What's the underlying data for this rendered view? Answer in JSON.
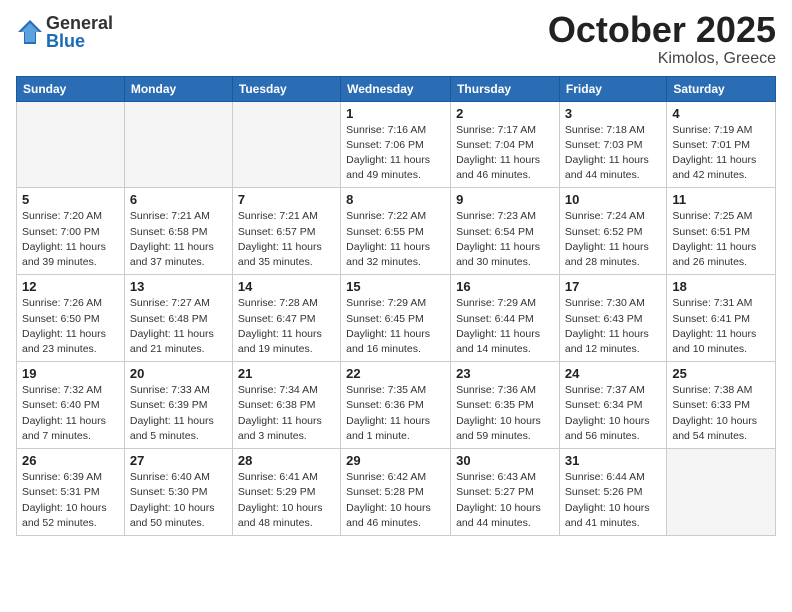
{
  "logo": {
    "general": "General",
    "blue": "Blue"
  },
  "title": "October 2025",
  "subtitle": "Kimolos, Greece",
  "days_of_week": [
    "Sunday",
    "Monday",
    "Tuesday",
    "Wednesday",
    "Thursday",
    "Friday",
    "Saturday"
  ],
  "weeks": [
    [
      {
        "day": "",
        "info": ""
      },
      {
        "day": "",
        "info": ""
      },
      {
        "day": "",
        "info": ""
      },
      {
        "day": "1",
        "info": "Sunrise: 7:16 AM\nSunset: 7:06 PM\nDaylight: 11 hours\nand 49 minutes."
      },
      {
        "day": "2",
        "info": "Sunrise: 7:17 AM\nSunset: 7:04 PM\nDaylight: 11 hours\nand 46 minutes."
      },
      {
        "day": "3",
        "info": "Sunrise: 7:18 AM\nSunset: 7:03 PM\nDaylight: 11 hours\nand 44 minutes."
      },
      {
        "day": "4",
        "info": "Sunrise: 7:19 AM\nSunset: 7:01 PM\nDaylight: 11 hours\nand 42 minutes."
      }
    ],
    [
      {
        "day": "5",
        "info": "Sunrise: 7:20 AM\nSunset: 7:00 PM\nDaylight: 11 hours\nand 39 minutes."
      },
      {
        "day": "6",
        "info": "Sunrise: 7:21 AM\nSunset: 6:58 PM\nDaylight: 11 hours\nand 37 minutes."
      },
      {
        "day": "7",
        "info": "Sunrise: 7:21 AM\nSunset: 6:57 PM\nDaylight: 11 hours\nand 35 minutes."
      },
      {
        "day": "8",
        "info": "Sunrise: 7:22 AM\nSunset: 6:55 PM\nDaylight: 11 hours\nand 32 minutes."
      },
      {
        "day": "9",
        "info": "Sunrise: 7:23 AM\nSunset: 6:54 PM\nDaylight: 11 hours\nand 30 minutes."
      },
      {
        "day": "10",
        "info": "Sunrise: 7:24 AM\nSunset: 6:52 PM\nDaylight: 11 hours\nand 28 minutes."
      },
      {
        "day": "11",
        "info": "Sunrise: 7:25 AM\nSunset: 6:51 PM\nDaylight: 11 hours\nand 26 minutes."
      }
    ],
    [
      {
        "day": "12",
        "info": "Sunrise: 7:26 AM\nSunset: 6:50 PM\nDaylight: 11 hours\nand 23 minutes."
      },
      {
        "day": "13",
        "info": "Sunrise: 7:27 AM\nSunset: 6:48 PM\nDaylight: 11 hours\nand 21 minutes."
      },
      {
        "day": "14",
        "info": "Sunrise: 7:28 AM\nSunset: 6:47 PM\nDaylight: 11 hours\nand 19 minutes."
      },
      {
        "day": "15",
        "info": "Sunrise: 7:29 AM\nSunset: 6:45 PM\nDaylight: 11 hours\nand 16 minutes."
      },
      {
        "day": "16",
        "info": "Sunrise: 7:29 AM\nSunset: 6:44 PM\nDaylight: 11 hours\nand 14 minutes."
      },
      {
        "day": "17",
        "info": "Sunrise: 7:30 AM\nSunset: 6:43 PM\nDaylight: 11 hours\nand 12 minutes."
      },
      {
        "day": "18",
        "info": "Sunrise: 7:31 AM\nSunset: 6:41 PM\nDaylight: 11 hours\nand 10 minutes."
      }
    ],
    [
      {
        "day": "19",
        "info": "Sunrise: 7:32 AM\nSunset: 6:40 PM\nDaylight: 11 hours\nand 7 minutes."
      },
      {
        "day": "20",
        "info": "Sunrise: 7:33 AM\nSunset: 6:39 PM\nDaylight: 11 hours\nand 5 minutes."
      },
      {
        "day": "21",
        "info": "Sunrise: 7:34 AM\nSunset: 6:38 PM\nDaylight: 11 hours\nand 3 minutes."
      },
      {
        "day": "22",
        "info": "Sunrise: 7:35 AM\nSunset: 6:36 PM\nDaylight: 11 hours\nand 1 minute."
      },
      {
        "day": "23",
        "info": "Sunrise: 7:36 AM\nSunset: 6:35 PM\nDaylight: 10 hours\nand 59 minutes."
      },
      {
        "day": "24",
        "info": "Sunrise: 7:37 AM\nSunset: 6:34 PM\nDaylight: 10 hours\nand 56 minutes."
      },
      {
        "day": "25",
        "info": "Sunrise: 7:38 AM\nSunset: 6:33 PM\nDaylight: 10 hours\nand 54 minutes."
      }
    ],
    [
      {
        "day": "26",
        "info": "Sunrise: 6:39 AM\nSunset: 5:31 PM\nDaylight: 10 hours\nand 52 minutes."
      },
      {
        "day": "27",
        "info": "Sunrise: 6:40 AM\nSunset: 5:30 PM\nDaylight: 10 hours\nand 50 minutes."
      },
      {
        "day": "28",
        "info": "Sunrise: 6:41 AM\nSunset: 5:29 PM\nDaylight: 10 hours\nand 48 minutes."
      },
      {
        "day": "29",
        "info": "Sunrise: 6:42 AM\nSunset: 5:28 PM\nDaylight: 10 hours\nand 46 minutes."
      },
      {
        "day": "30",
        "info": "Sunrise: 6:43 AM\nSunset: 5:27 PM\nDaylight: 10 hours\nand 44 minutes."
      },
      {
        "day": "31",
        "info": "Sunrise: 6:44 AM\nSunset: 5:26 PM\nDaylight: 10 hours\nand 41 minutes."
      },
      {
        "day": "",
        "info": ""
      }
    ]
  ]
}
